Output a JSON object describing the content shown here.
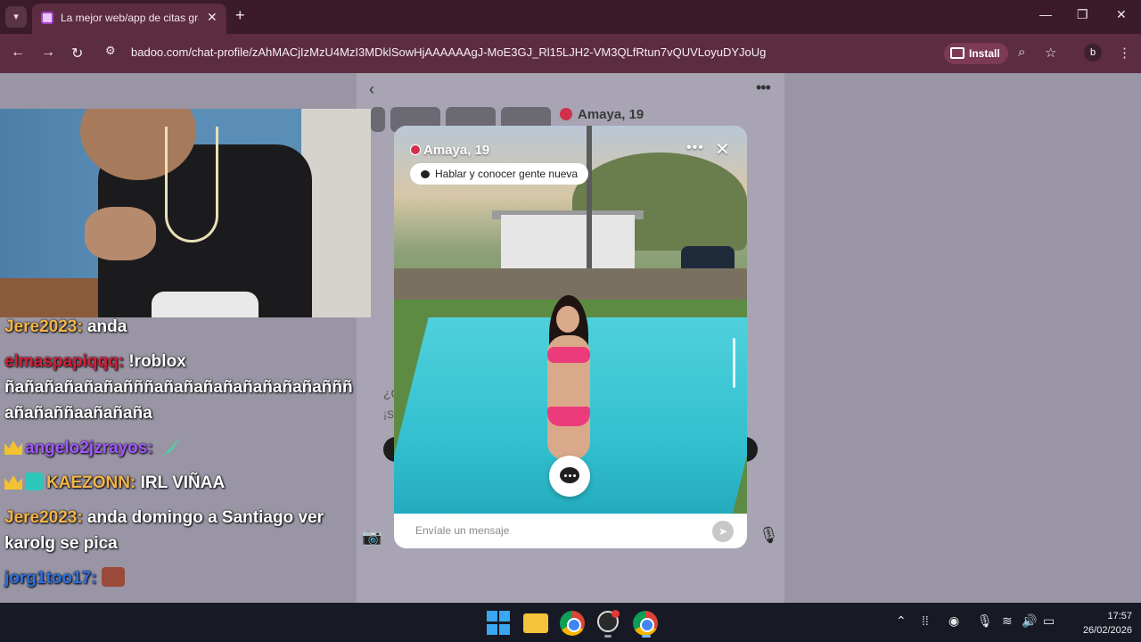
{
  "browser": {
    "tab_title": "La mejor web/app de citas grat",
    "tab_close": "✕",
    "new_tab": "+",
    "url": "badoo.com/chat-profile/zAhMACjIzMzU4MzI3MDklSowHjAAAAAAgJ-MoE3GJ_Rl15LJH2-VM3QLfRtun7vQUVLoyuDYJoUg",
    "install_label": "Install",
    "profile_initial": "b",
    "window_controls": {
      "minimize": "—",
      "maximize": "❐",
      "close": "✕"
    },
    "nav": {
      "back": "←",
      "forward": "→",
      "reload": "↻"
    },
    "icons": {
      "site_settings": "tune-icon",
      "zoom": "magnifier-icon",
      "bookmark": "star-icon",
      "menu": "kebab-icon"
    }
  },
  "page": {
    "header_name": "Amaya, 19",
    "bg_question": "¿C",
    "bg_sub": "¡Se"
  },
  "chat": [
    {
      "user": "Jere2023",
      "user_color": "#f3b54a",
      "text": "anda"
    },
    {
      "user": "elmaspapiqqq",
      "user_color": "#d3203a",
      "text": "!roblox ñañañañañañañññañañañañañañañañañññ añañaññaañañaña"
    },
    {
      "user": "angelo2jzrayos",
      "user_color": "#a259ff",
      "text": "",
      "badge": "crown",
      "emote": "feather-emote"
    },
    {
      "user": "KAEZONN",
      "user_color": "#f3b54a",
      "text": "IRL VIÑAA",
      "badge": "crown",
      "badge2": "sub-badge"
    },
    {
      "user": "Jere2023",
      "user_color": "#f3b54a",
      "text": "anda domingo a Santiago ver karolg se pica"
    },
    {
      "user": "jorg1too17",
      "user_color": "#2f6fe0",
      "text": "",
      "emote": "face-emote"
    }
  ],
  "modal": {
    "name": "Amaya, 19",
    "tag": "Hablar y conocer gente nueva",
    "more": "•••",
    "close": "✕",
    "input_placeholder": "Envíale un mensaje"
  },
  "taskbar": {
    "time": "17:57",
    "date": "26/02/2026",
    "apps": [
      "windows-start-icon",
      "file-explorer-icon",
      "chrome-icon",
      "obs-icon",
      "chrome-profile-icon"
    ]
  },
  "colors": {
    "chrome_dark": "#3b1b2a",
    "chrome_toolbar": "#5c2c41",
    "badoo_red": "#d0304b",
    "bikini_pink": "#ec3b7b"
  }
}
